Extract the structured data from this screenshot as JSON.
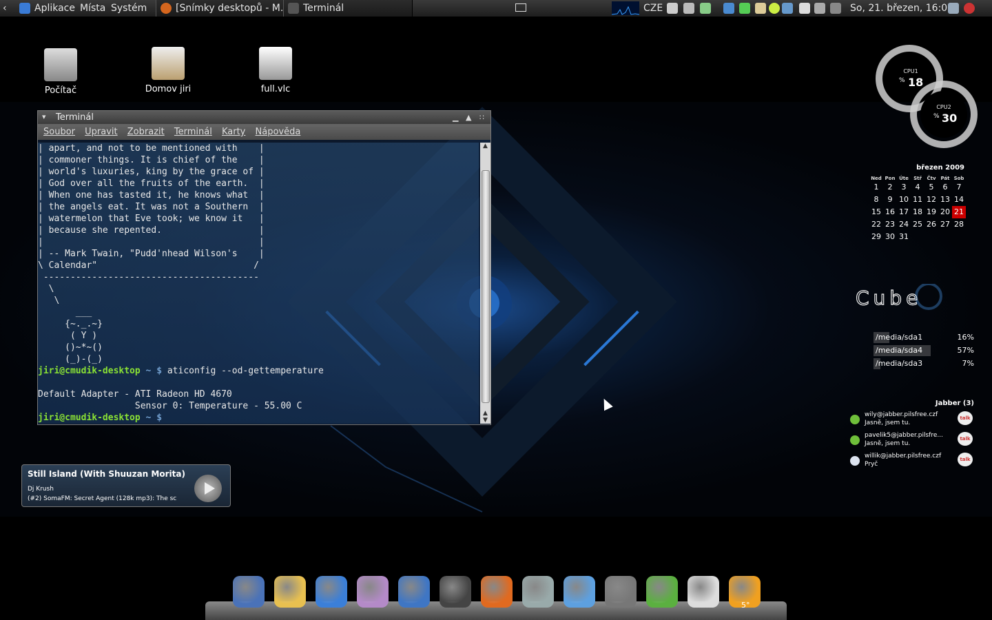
{
  "top_panel": {
    "menus": [
      "Aplikace",
      "Místa",
      "Systém"
    ],
    "tasks": [
      "[Snímky desktopů - M...",
      "Terminál"
    ],
    "keyboard_layout": "CZE",
    "clock": "So, 21. březen, 16:00"
  },
  "desktop_icons": [
    {
      "label": "Počítač",
      "icon": "computer-icon"
    },
    {
      "label": "Domov jiri",
      "icon": "home-folder-icon"
    },
    {
      "label": "full.vlc",
      "icon": "m3u-playlist-icon"
    }
  ],
  "terminal": {
    "title": "Terminál",
    "menu": [
      "Soubor",
      "Upravit",
      "Zobrazit",
      "Terminál",
      "Karty",
      "Nápověda"
    ],
    "fortune_lines": [
      "| apart, and not to be mentioned with    |",
      "| commoner things. It is chief of the    |",
      "| world's luxuries, king by the grace of |",
      "| God over all the fruits of the earth.  |",
      "| When one has tasted it, he knows what  |",
      "| the angels eat. It was not a Southern  |",
      "| watermelon that Eve took; we know it   |",
      "| because she repented.                  |",
      "|                                        |",
      "| -- Mark Twain, \"Pudd'nhead Wilson's    |",
      "\\ Calendar\"                             /",
      " ----------------------------------------",
      "  \\",
      "   \\",
      "       ___",
      "     {~._.~}",
      "      ( Y )",
      "     ()~*~()",
      "     (_)-(_)"
    ],
    "prompt_user": "jiri@cmudik-desktop",
    "prompt_rest": " ~ $ ",
    "command": "aticonfig --od-gettemperature",
    "output_lines": [
      "",
      "Default Adapter - ATI Radeon HD 4670",
      "                  Sensor 0: Temperature - 55.00 C"
    ]
  },
  "cpu": [
    {
      "label": "CPU1",
      "unit": "%",
      "value": "18"
    },
    {
      "label": "CPU2",
      "unit": "%",
      "value": "30"
    }
  ],
  "calendar": {
    "title": "březen 2009",
    "weekdays": [
      "Ned",
      "Pon",
      "Úte",
      "Stř",
      "Čtv",
      "Pát",
      "Sob"
    ],
    "weeks": [
      [
        "1",
        "2",
        "3",
        "4",
        "5",
        "6",
        "7"
      ],
      [
        "8",
        "9",
        "10",
        "11",
        "12",
        "13",
        "14"
      ],
      [
        "15",
        "16",
        "17",
        "18",
        "19",
        "20",
        "21"
      ],
      [
        "22",
        "23",
        "24",
        "25",
        "26",
        "27",
        "28"
      ],
      [
        "29",
        "30",
        "31",
        "",
        "",
        "",
        ""
      ]
    ],
    "today": "21"
  },
  "logo_text": "Cube",
  "disks": [
    {
      "name": "/media/sda1",
      "percent": "16%",
      "usage": 0.16
    },
    {
      "name": "/media/sda4",
      "percent": "57%",
      "usage": 0.57
    },
    {
      "name": "/media/sda3",
      "percent": "7%",
      "usage": 0.07
    }
  ],
  "jabber": {
    "title": "Jabber (3)",
    "contacts": [
      {
        "jid": "wily@jabber.pilsfree.czf",
        "message": "Jasně, jsem tu.",
        "status_color": "#6fbf3a"
      },
      {
        "jid": "pavelik5@jabber.pilsfre...",
        "message": "Jasně, jsem tu.",
        "status_color": "#6fbf3a"
      },
      {
        "jid": "willik@jabber.pilsfree.czf",
        "message": "Pryč",
        "status_color": "#dde4f0"
      }
    ],
    "badge": "talk"
  },
  "player": {
    "song": "Still Island (With Shuuzan Morita)",
    "artist": "Dj Krush",
    "stream": "(#2) SomaFM: Secret Agent (128k mp3): The sc"
  },
  "dock": {
    "icons": [
      "deluge-icon",
      "pidgin-icon",
      "thunderbird-icon",
      "gwibber-icon",
      "firefox-icon",
      "terminal-icon",
      "media-player-icon",
      "video-editor-icon",
      "pointer-icon",
      "audacious-icon",
      "gnome-do-icon",
      "gnome-games-icon",
      "weather-icon"
    ],
    "weather_temp": "5°"
  },
  "colors": {
    "panel": "#2a2a2a",
    "prompt_user": "#8ae234",
    "prompt_path": "#729fcf",
    "today": "#cc0000"
  }
}
